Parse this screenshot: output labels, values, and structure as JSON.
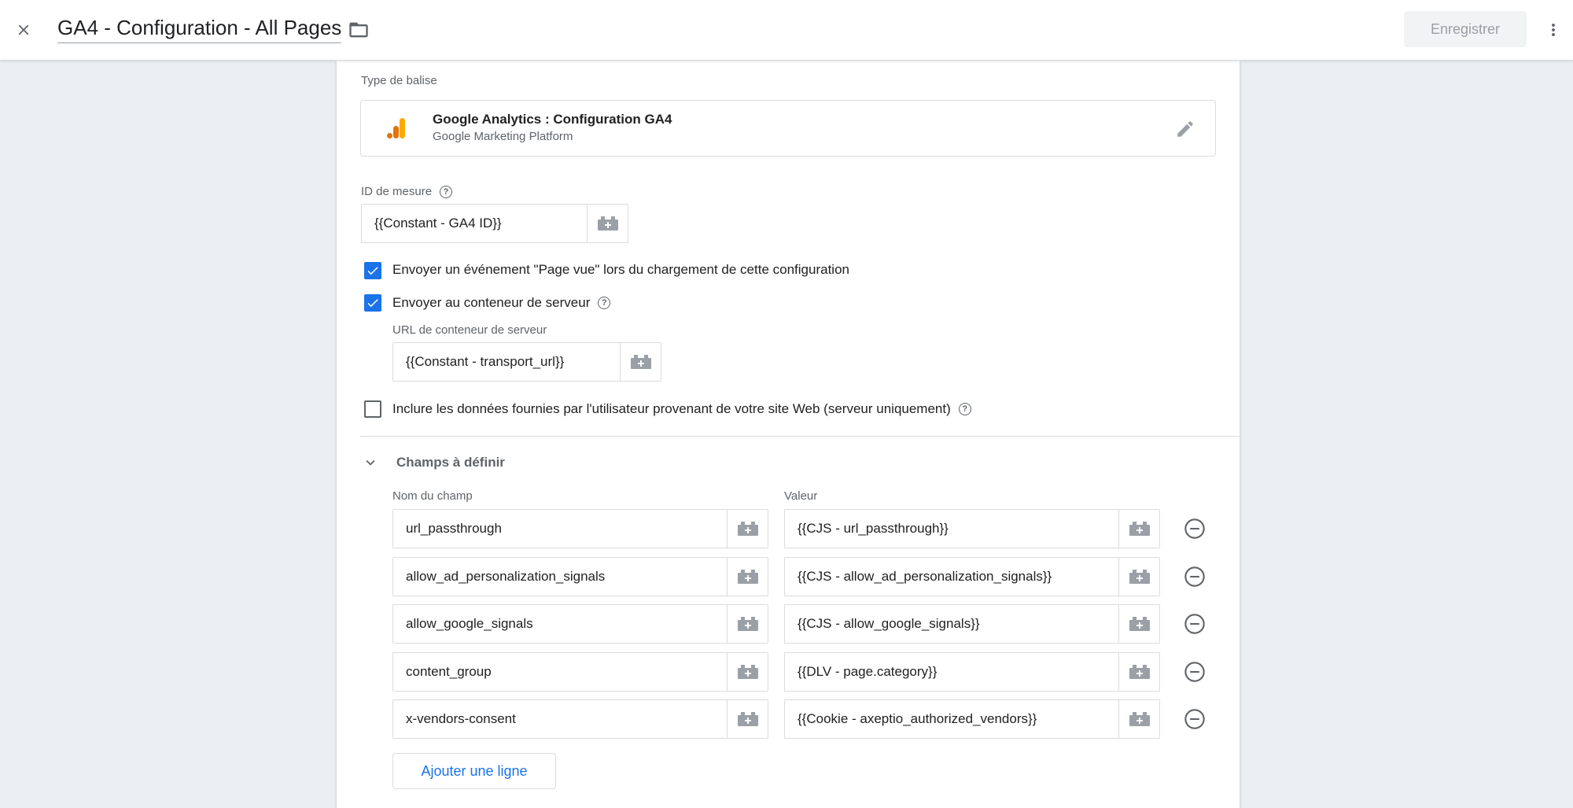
{
  "header": {
    "title": "GA4 - Configuration - All Pages",
    "save_label": "Enregistrer"
  },
  "tag_type": {
    "section_label": "Type de balise",
    "name": "Google Analytics : Configuration GA4",
    "provider": "Google Marketing Platform",
    "icon": "google-analytics-icon"
  },
  "measurement_id": {
    "label": "ID de mesure",
    "value": "{{Constant - GA4 ID}}"
  },
  "options": {
    "send_page_view": {
      "label": "Envoyer un événement \"Page vue\" lors du chargement de cette configuration",
      "checked": true
    },
    "send_to_server": {
      "label": "Envoyer au conteneur de serveur",
      "checked": true
    },
    "server_url": {
      "label": "URL de conteneur de serveur",
      "value": "{{Constant - transport_url}}"
    },
    "include_user_data": {
      "label": "Inclure les données fournies par l'utilisateur provenant de votre site Web (serveur uniquement)",
      "checked": false
    }
  },
  "fields_section": {
    "title": "Champs à définir",
    "col_name": "Nom du champ",
    "col_value": "Valeur",
    "rows": [
      {
        "name": "url_passthrough",
        "value": "{{CJS - url_passthrough}}"
      },
      {
        "name": "allow_ad_personalization_signals",
        "value": "{{CJS - allow_ad_personalization_signals}}"
      },
      {
        "name": "allow_google_signals",
        "value": "{{CJS - allow_google_signals}}"
      },
      {
        "name": "content_group",
        "value": "{{DLV - page.category}}"
      },
      {
        "name": "x-vendors-consent",
        "value": "{{Cookie - axeptio_authorized_vendors}}"
      }
    ],
    "add_row_label": "Ajouter une ligne"
  },
  "colors": {
    "accent": "#1a73e8",
    "ga_orange": "#f9ab00",
    "ga_dark_orange": "#e37400"
  }
}
